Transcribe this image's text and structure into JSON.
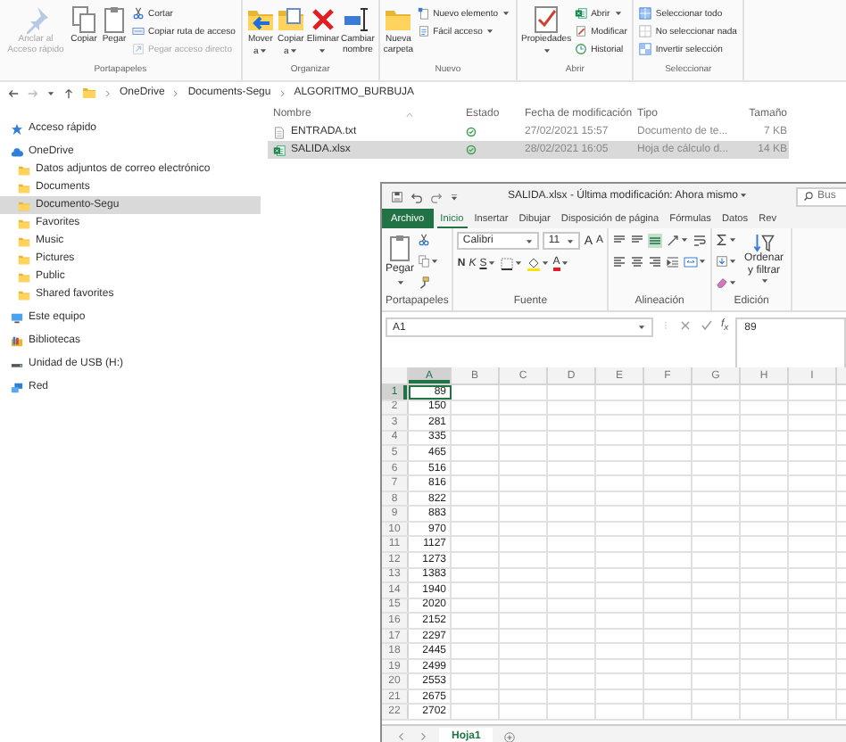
{
  "explorer": {
    "ribbon": {
      "groups": [
        {
          "label": "Portapapeles",
          "large": [
            {
              "label": "Anclar al Acceso rápido",
              "disabled": true,
              "menu": false
            },
            {
              "label": "Copiar",
              "disabled": false,
              "menu": false
            },
            {
              "label": "Pegar",
              "disabled": false,
              "menu": false
            }
          ],
          "small": [
            {
              "label": "Cortar",
              "disabled": false,
              "menu": false
            },
            {
              "label": "Copiar ruta de acceso",
              "disabled": false,
              "menu": false
            },
            {
              "label": "Pegar acceso directo",
              "disabled": true,
              "menu": false
            }
          ]
        },
        {
          "label": "Organizar",
          "large": [
            {
              "label": "Mover a",
              "disabled": false,
              "menu": true
            },
            {
              "label": "Copiar a",
              "disabled": false,
              "menu": true
            },
            {
              "label": "Eliminar",
              "disabled": false,
              "menu": true
            },
            {
              "label": "Cambiar nombre",
              "disabled": false,
              "menu": false
            }
          ]
        },
        {
          "label": "Nuevo",
          "large": [
            {
              "label": "Nueva carpeta",
              "disabled": false,
              "menu": false
            }
          ],
          "small": [
            {
              "label": "Nuevo elemento",
              "disabled": false,
              "menu": true
            },
            {
              "label": "Fácil acceso",
              "disabled": false,
              "menu": true
            }
          ]
        },
        {
          "label": "Abrir",
          "large": [
            {
              "label": "Propiedades",
              "disabled": false,
              "menu": true
            }
          ],
          "small": [
            {
              "label": "Abrir",
              "disabled": false,
              "menu": true
            },
            {
              "label": "Modificar",
              "disabled": false,
              "menu": false
            },
            {
              "label": "Historial",
              "disabled": false,
              "menu": false
            }
          ]
        },
        {
          "label": "Seleccionar",
          "small": [
            {
              "label": "Seleccionar todo",
              "disabled": false,
              "menu": false
            },
            {
              "label": "No seleccionar nada",
              "disabled": false,
              "menu": false
            },
            {
              "label": "Invertir selección",
              "disabled": false,
              "menu": false
            }
          ]
        }
      ]
    },
    "breadcrumb": [
      "OneDrive",
      "Documents-Segu",
      "ALGORITMO_BURBUJA"
    ],
    "sidebar": {
      "items": [
        {
          "label": "Acceso rápido",
          "kind": "quick",
          "selected": false
        },
        {
          "label": "OneDrive",
          "kind": "cloud",
          "selected": false,
          "children": [
            {
              "label": "Datos adjuntos de correo electrónico",
              "kind": "folder",
              "selected": false
            },
            {
              "label": "Documents",
              "kind": "folder",
              "selected": false
            },
            {
              "label": "Documento-Segu",
              "kind": "folder",
              "selected": true
            },
            {
              "label": "Favorites",
              "kind": "folder",
              "selected": false
            },
            {
              "label": "Music",
              "kind": "folder",
              "selected": false
            },
            {
              "label": "Pictures",
              "kind": "folder",
              "selected": false
            },
            {
              "label": "Public",
              "kind": "folder",
              "selected": false
            },
            {
              "label": "Shared favorites",
              "kind": "folder",
              "selected": false
            }
          ]
        },
        {
          "label": "Este equipo",
          "kind": "pc",
          "selected": false
        },
        {
          "label": "Bibliotecas",
          "kind": "libraries",
          "selected": false
        },
        {
          "label": "Unidad de USB (H:)",
          "kind": "usb",
          "selected": false
        },
        {
          "label": "Red",
          "kind": "network",
          "selected": false
        }
      ]
    },
    "files": {
      "columns": [
        "Nombre",
        "Estado",
        "Fecha de modificación",
        "Tipo",
        "Tamaño"
      ],
      "rows": [
        {
          "name": "ENTRADA.txt",
          "kind": "text",
          "modified": "27/02/2021 15:57",
          "type": "Documento de te...",
          "size": "7 KB",
          "selected": false
        },
        {
          "name": "SALIDA.xlsx",
          "kind": "excel",
          "modified": "28/02/2021 16:05",
          "type": "Hoja de cálculo d...",
          "size": "14 KB",
          "selected": true
        }
      ]
    }
  },
  "excel": {
    "title": "SALIDA.xlsx - Última modificación: Ahora mismo",
    "search_placeholder": "Bus",
    "tabs": [
      {
        "label": "Archivo",
        "kind": "file",
        "selected": false
      },
      {
        "label": "Inicio",
        "kind": "tab",
        "selected": true
      },
      {
        "label": "Insertar",
        "kind": "tab",
        "selected": false
      },
      {
        "label": "Dibujar",
        "kind": "tab",
        "selected": false
      },
      {
        "label": "Disposición de página",
        "kind": "tab",
        "selected": false
      },
      {
        "label": "Fórmulas",
        "kind": "tab",
        "selected": false
      },
      {
        "label": "Datos",
        "kind": "tab",
        "selected": false
      },
      {
        "label": "Rev",
        "kind": "tab",
        "selected": false
      }
    ],
    "ribbon": {
      "group_labels": [
        "Portapapeles",
        "Fuente",
        "Alineación",
        "Edición"
      ],
      "paste": "Pegar",
      "font": "Calibri",
      "font_size": "11",
      "grow_font": "A",
      "shrink_font": "A",
      "bold": "N",
      "italic": "K",
      "underline": "S",
      "font_color": "A",
      "sort": "Ordenar y filtrar"
    },
    "name_box": "A1",
    "fx": "f$_{x}$",
    "formula": "89",
    "sheet": {
      "columns": [
        {
          "label": "A",
          "selected": true
        },
        {
          "label": "B",
          "selected": false
        },
        {
          "label": "C",
          "selected": false
        },
        {
          "label": "D",
          "selected": false
        },
        {
          "label": "E",
          "selected": false
        },
        {
          "label": "F",
          "selected": false
        },
        {
          "label": "G",
          "selected": false
        },
        {
          "label": "H",
          "selected": false
        },
        {
          "label": "I",
          "selected": false
        }
      ],
      "rows": [
        {
          "label": "1",
          "value": "89",
          "selected": true
        },
        {
          "label": "2",
          "value": "150",
          "selected": false
        },
        {
          "label": "3",
          "value": "281",
          "selected": false
        },
        {
          "label": "4",
          "value": "335",
          "selected": false
        },
        {
          "label": "5",
          "value": "465",
          "selected": false
        },
        {
          "label": "6",
          "value": "516",
          "selected": false
        },
        {
          "label": "7",
          "value": "816",
          "selected": false
        },
        {
          "label": "8",
          "value": "822",
          "selected": false
        },
        {
          "label": "9",
          "value": "883",
          "selected": false
        },
        {
          "label": "10",
          "value": "970",
          "selected": false
        },
        {
          "label": "11",
          "value": "1127",
          "selected": false
        },
        {
          "label": "12",
          "value": "1273",
          "selected": false
        },
        {
          "label": "13",
          "value": "1383",
          "selected": false
        },
        {
          "label": "14",
          "value": "1940",
          "selected": false
        },
        {
          "label": "15",
          "value": "2020",
          "selected": false
        },
        {
          "label": "16",
          "value": "2152",
          "selected": false
        },
        {
          "label": "17",
          "value": "2297",
          "selected": false
        },
        {
          "label": "18",
          "value": "2445",
          "selected": false
        },
        {
          "label": "19",
          "value": "2499",
          "selected": false
        },
        {
          "label": "20",
          "value": "2553",
          "selected": false
        },
        {
          "label": "21",
          "value": "2675",
          "selected": false
        },
        {
          "label": "22",
          "value": "2702",
          "selected": false
        }
      ]
    },
    "sheet_tabs": [
      {
        "label": "Hoja1",
        "selected": true
      }
    ]
  }
}
